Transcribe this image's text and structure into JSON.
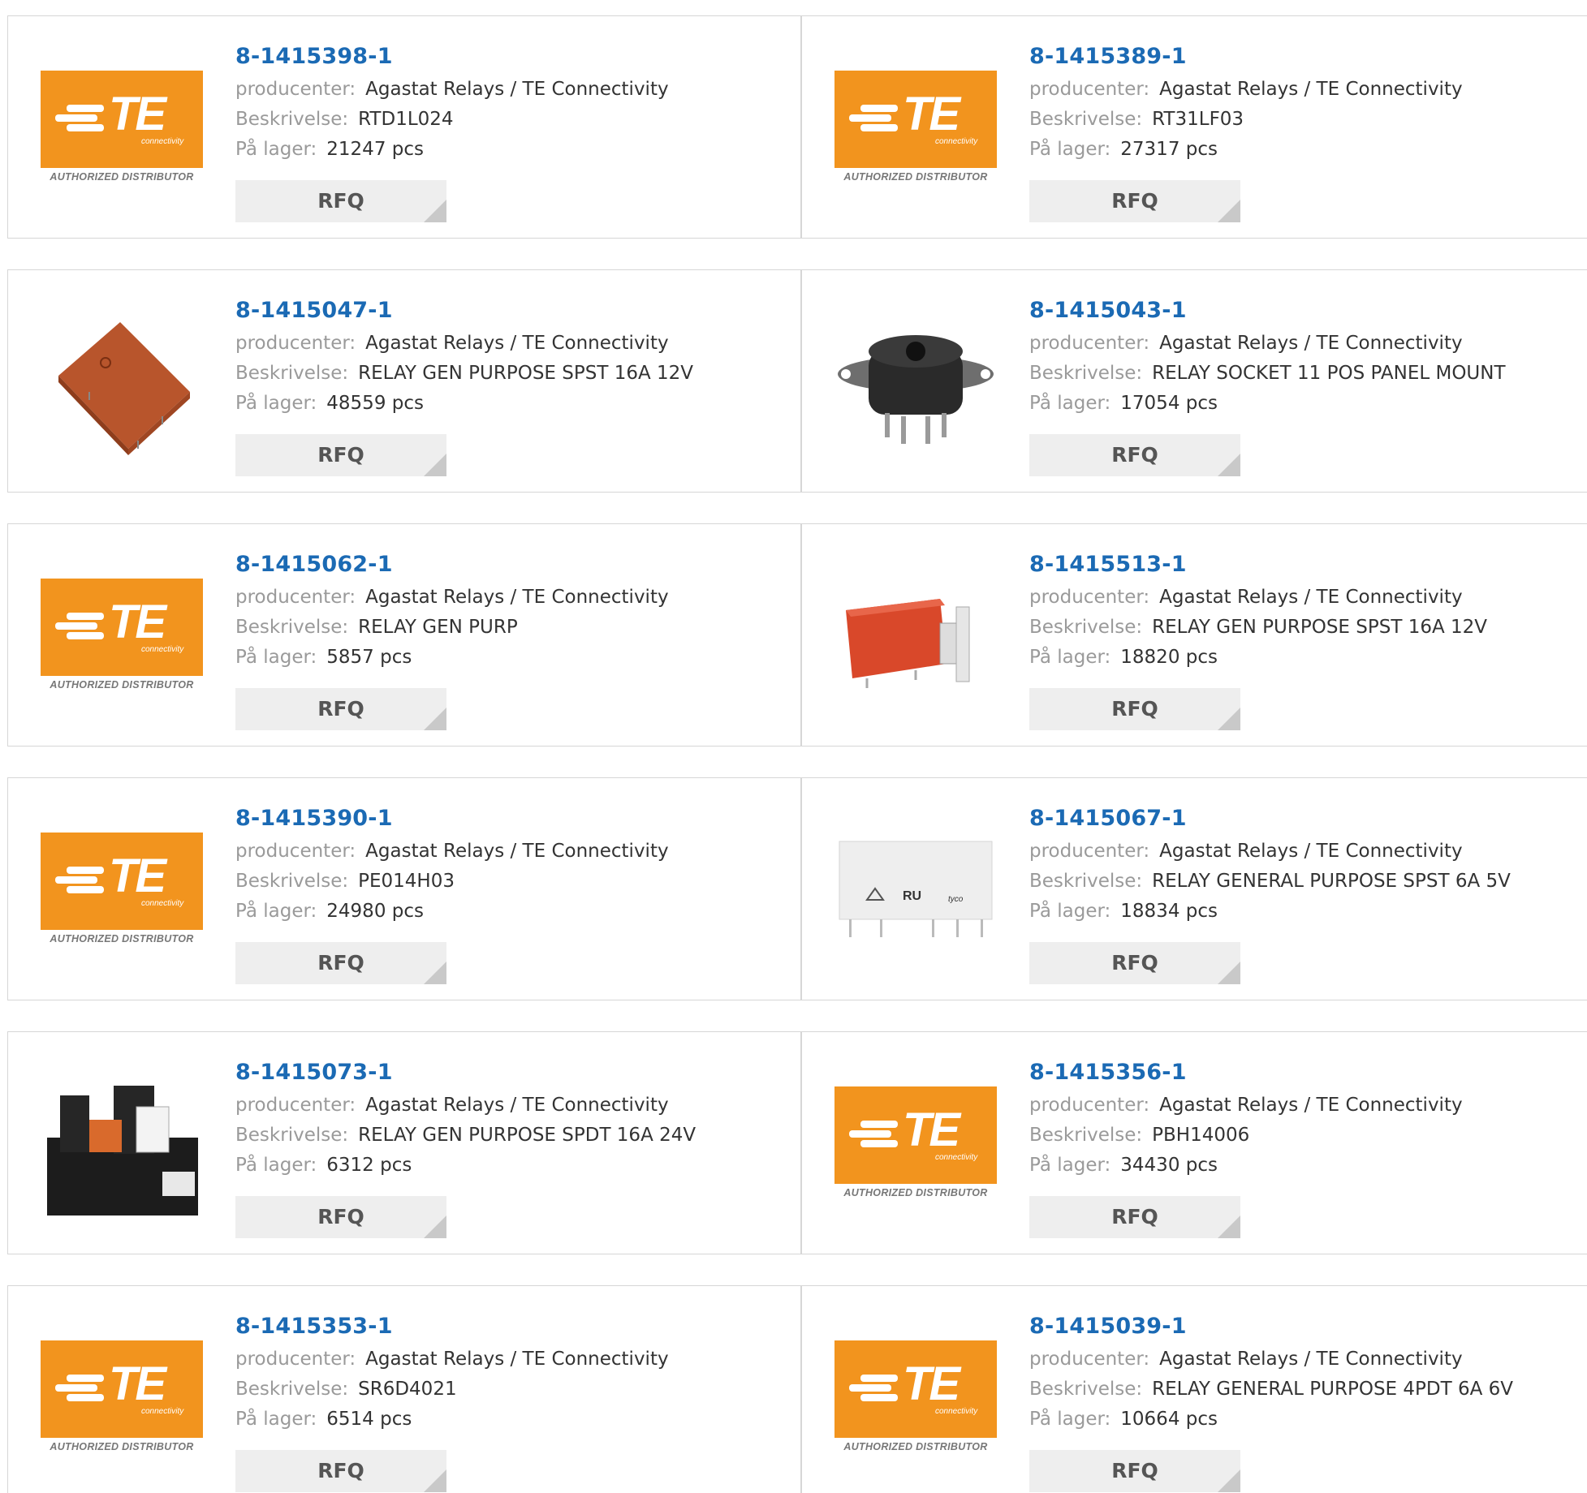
{
  "labels": {
    "manufacturer": "producenter:",
    "description": "Beskrivelse:",
    "stock": "På lager:",
    "rfq": "RFQ"
  },
  "logo": {
    "text": "TE",
    "sub": "connectivity",
    "authorized": "AUTHORIZED DISTRIBUTOR"
  },
  "products": [
    {
      "part": "8-1415398-1",
      "manufacturer": "Agastat Relays / TE Connectivity",
      "description": "RTD1L024",
      "stock": "21247 pcs",
      "image": "te-logo"
    },
    {
      "part": "8-1415389-1",
      "manufacturer": "Agastat Relays / TE Connectivity",
      "description": "RT31LF03",
      "stock": "27317 pcs",
      "image": "te-logo"
    },
    {
      "part": "8-1415047-1",
      "manufacturer": "Agastat Relays / TE Connectivity",
      "description": "RELAY GEN PURPOSE SPST 16A 12V",
      "stock": "48559 pcs",
      "image": "relay-brown"
    },
    {
      "part": "8-1415043-1",
      "manufacturer": "Agastat Relays / TE Connectivity",
      "description": "RELAY SOCKET 11 POS PANEL MOUNT",
      "stock": "17054 pcs",
      "image": "relay-socket"
    },
    {
      "part": "8-1415062-1",
      "manufacturer": "Agastat Relays / TE Connectivity",
      "description": "RELAY GEN PURP",
      "stock": "5857 pcs",
      "image": "te-logo"
    },
    {
      "part": "8-1415513-1",
      "manufacturer": "Agastat Relays / TE Connectivity",
      "description": "RELAY GEN PURPOSE SPST 16A 12V",
      "stock": "18820 pcs",
      "image": "relay-red"
    },
    {
      "part": "8-1415390-1",
      "manufacturer": "Agastat Relays / TE Connectivity",
      "description": "PE014H03",
      "stock": "24980 pcs",
      "image": "te-logo"
    },
    {
      "part": "8-1415067-1",
      "manufacturer": "Agastat Relays / TE Connectivity",
      "description": "RELAY GENERAL PURPOSE SPST 6A 5V",
      "stock": "18834 pcs",
      "image": "relay-white"
    },
    {
      "part": "8-1415073-1",
      "manufacturer": "Agastat Relays / TE Connectivity",
      "description": "RELAY GEN PURPOSE SPDT 16A 24V",
      "stock": "6312 pcs",
      "image": "relay-din"
    },
    {
      "part": "8-1415356-1",
      "manufacturer": "Agastat Relays / TE Connectivity",
      "description": "PBH14006",
      "stock": "34430 pcs",
      "image": "te-logo"
    },
    {
      "part": "8-1415353-1",
      "manufacturer": "Agastat Relays / TE Connectivity",
      "description": "SR6D4021",
      "stock": "6514 pcs",
      "image": "te-logo"
    },
    {
      "part": "8-1415039-1",
      "manufacturer": "Agastat Relays / TE Connectivity",
      "description": "RELAY GENERAL PURPOSE 4PDT 6A 6V",
      "stock": "10664 pcs",
      "image": "te-logo"
    }
  ]
}
